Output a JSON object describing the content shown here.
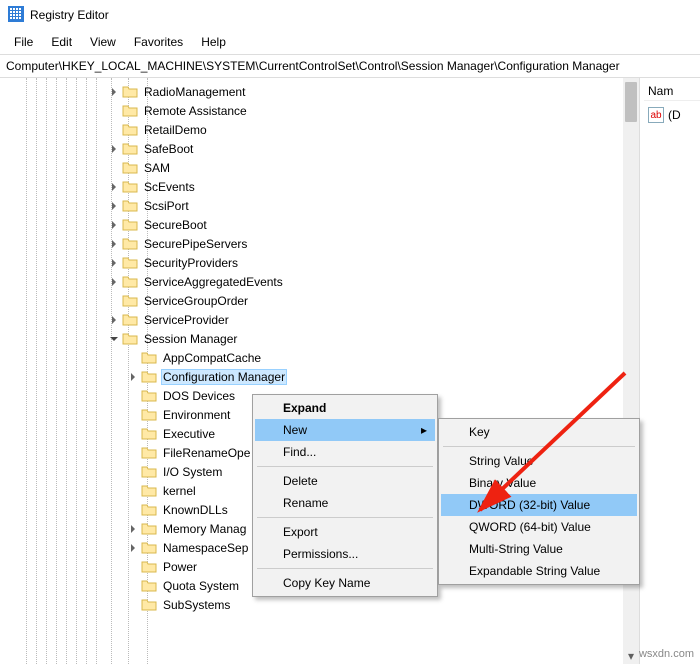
{
  "window": {
    "title": "Registry Editor"
  },
  "menubar": [
    "File",
    "Edit",
    "View",
    "Favorites",
    "Help"
  ],
  "addressbar": "Computer\\HKEY_LOCAL_MACHINE\\SYSTEM\\CurrentControlSet\\Control\\Session Manager\\Configuration Manager",
  "list": {
    "header": "Nam",
    "default_value": "(D"
  },
  "tree": {
    "items": [
      {
        "label": "RadioManagement",
        "twisty": "right",
        "indent": 122
      },
      {
        "label": "Remote Assistance",
        "twisty": "",
        "indent": 122
      },
      {
        "label": "RetailDemo",
        "twisty": "",
        "indent": 122
      },
      {
        "label": "SafeBoot",
        "twisty": "right",
        "indent": 122
      },
      {
        "label": "SAM",
        "twisty": "",
        "indent": 122
      },
      {
        "label": "ScEvents",
        "twisty": "right",
        "indent": 122
      },
      {
        "label": "ScsiPort",
        "twisty": "right",
        "indent": 122
      },
      {
        "label": "SecureBoot",
        "twisty": "right",
        "indent": 122
      },
      {
        "label": "SecurePipeServers",
        "twisty": "right",
        "indent": 122
      },
      {
        "label": "SecurityProviders",
        "twisty": "right",
        "indent": 122
      },
      {
        "label": "ServiceAggregatedEvents",
        "twisty": "right",
        "indent": 122
      },
      {
        "label": "ServiceGroupOrder",
        "twisty": "",
        "indent": 122
      },
      {
        "label": "ServiceProvider",
        "twisty": "right",
        "indent": 122
      },
      {
        "label": "Session Manager",
        "twisty": "down",
        "indent": 122
      },
      {
        "label": "AppCompatCache",
        "twisty": "",
        "indent": 141
      },
      {
        "label": "Configuration Manager",
        "twisty": "right",
        "indent": 141,
        "selected": true
      },
      {
        "label": "DOS Devices",
        "twisty": "",
        "indent": 141
      },
      {
        "label": "Environment",
        "twisty": "",
        "indent": 141
      },
      {
        "label": "Executive",
        "twisty": "",
        "indent": 141
      },
      {
        "label": "FileRenameOpe",
        "twisty": "",
        "indent": 141
      },
      {
        "label": "I/O System",
        "twisty": "",
        "indent": 141
      },
      {
        "label": "kernel",
        "twisty": "",
        "indent": 141
      },
      {
        "label": "KnownDLLs",
        "twisty": "",
        "indent": 141
      },
      {
        "label": "Memory Manag",
        "twisty": "right",
        "indent": 141
      },
      {
        "label": "NamespaceSep",
        "twisty": "right",
        "indent": 141
      },
      {
        "label": "Power",
        "twisty": "",
        "indent": 141
      },
      {
        "label": "Quota System",
        "twisty": "",
        "indent": 141
      },
      {
        "label": "SubSystems",
        "twisty": "",
        "indent": 141
      }
    ]
  },
  "context_menu": {
    "items": [
      {
        "label": "Expand",
        "bold": true
      },
      {
        "label": "New",
        "submenu": true,
        "hover": true
      },
      {
        "label": "Find..."
      },
      {
        "sep": true
      },
      {
        "label": "Delete"
      },
      {
        "label": "Rename"
      },
      {
        "sep": true
      },
      {
        "label": "Export"
      },
      {
        "label": "Permissions..."
      },
      {
        "sep": true
      },
      {
        "label": "Copy Key Name"
      }
    ]
  },
  "submenu": {
    "items": [
      {
        "label": "Key"
      },
      {
        "sep": true
      },
      {
        "label": "String Value"
      },
      {
        "label": "Binary Value"
      },
      {
        "label": "DWORD (32-bit) Value",
        "hover": true
      },
      {
        "label": "QWORD (64-bit) Value"
      },
      {
        "label": "Multi-String Value"
      },
      {
        "label": "Expandable String Value"
      }
    ]
  },
  "watermark": "wsxdn.com",
  "guides": [
    26,
    36,
    46,
    56,
    66,
    76,
    86,
    96,
    111,
    128,
    147
  ]
}
